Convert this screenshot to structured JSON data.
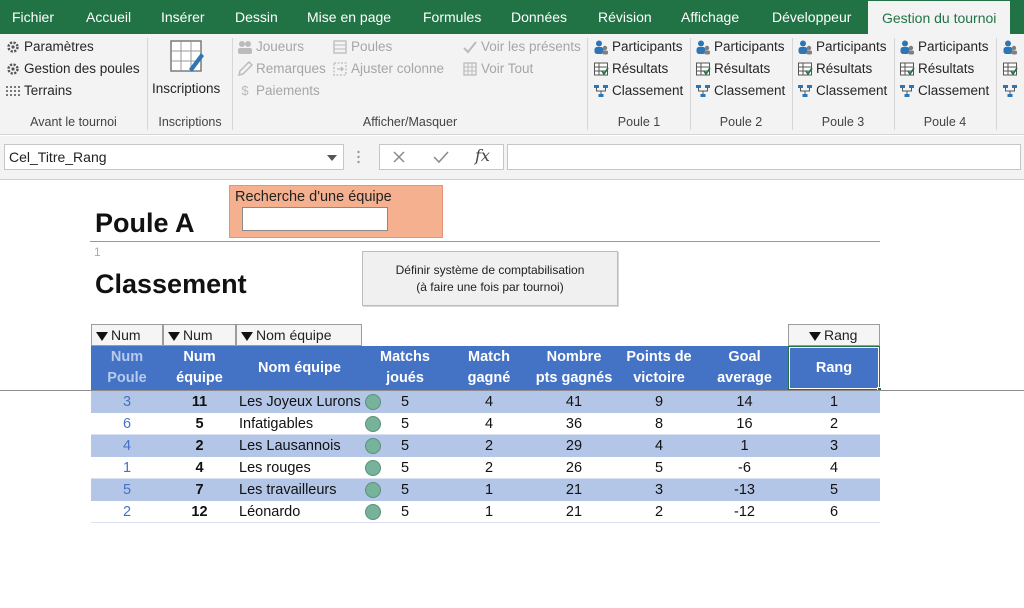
{
  "menu": {
    "tabs": [
      "Fichier",
      "Accueil",
      "Insérer",
      "Dessin",
      "Mise en page",
      "Formules",
      "Données",
      "Révision",
      "Affichage",
      "Développeur",
      "Gestion du tournoi"
    ],
    "active_tab": "Gestion du tournoi"
  },
  "ribbon": {
    "avant": {
      "items": [
        "Paramètres",
        "Gestion des poules",
        "Terrains"
      ],
      "label": "Avant le tournoi"
    },
    "inscriptions": {
      "button": "Inscriptions",
      "label": "Inscriptions"
    },
    "afficher": {
      "col1": [
        "Joueurs",
        "Remarques",
        "Paiements"
      ],
      "col2": [
        "Poules",
        "Ajuster colonne"
      ],
      "col3": [
        "Voir les présents",
        "Voir Tout"
      ],
      "label": "Afficher/Masquer"
    },
    "poule_items": [
      "Participants",
      "Résultats",
      "Classement"
    ],
    "poule_labels": [
      "Poule 1",
      "Poule 2",
      "Poule 3",
      "Poule 4"
    ]
  },
  "formula_bar": {
    "name_box": "Cel_Titre_Rang",
    "fx": "fx",
    "value": ""
  },
  "sheet": {
    "title": "Poule A",
    "row_number": "1",
    "subtitle": "Classement",
    "search": {
      "label": "Recherche d'une équipe",
      "value": ""
    },
    "define_button": [
      "Définir système de comptabilisation",
      "(à faire une fois par tournoi)"
    ],
    "filters": [
      "Num",
      "Num",
      "Nom équipe",
      "Rang"
    ],
    "headers": [
      [
        "Num",
        "Poule"
      ],
      [
        "Num",
        "équipe"
      ],
      [
        "Nom équipe"
      ],
      [
        "Matchs",
        "joués"
      ],
      [
        "Match",
        "gagné"
      ],
      [
        "Nombre",
        "pts gagnés"
      ],
      [
        "Points de",
        "victoire"
      ],
      [
        "Goal",
        "average"
      ],
      [
        "Rang"
      ]
    ],
    "rows": [
      {
        "poule": "3",
        "equipe": "11",
        "nom": "Les Joyeux Lurons",
        "joues": "5",
        "gagne": "4",
        "pts": "41",
        "victoire": "9",
        "goal": "14",
        "rang": "1"
      },
      {
        "poule": "6",
        "equipe": "5",
        "nom": "Infatigables",
        "joues": "5",
        "gagne": "4",
        "pts": "36",
        "victoire": "8",
        "goal": "16",
        "rang": "2"
      },
      {
        "poule": "4",
        "equipe": "2",
        "nom": "Les Lausannois",
        "joues": "5",
        "gagne": "2",
        "pts": "29",
        "victoire": "4",
        "goal": "1",
        "rang": "3"
      },
      {
        "poule": "1",
        "equipe": "4",
        "nom": "Les rouges",
        "joues": "5",
        "gagne": "2",
        "pts": "26",
        "victoire": "5",
        "goal": "-6",
        "rang": "4"
      },
      {
        "poule": "5",
        "equipe": "7",
        "nom": "Les travailleurs",
        "joues": "5",
        "gagne": "1",
        "pts": "21",
        "victoire": "3",
        "goal": "-13",
        "rang": "5"
      },
      {
        "poule": "2",
        "equipe": "12",
        "nom": "Léonardo",
        "joues": "5",
        "gagne": "1",
        "pts": "21",
        "victoire": "2",
        "goal": "-12",
        "rang": "6"
      }
    ]
  },
  "colors": {
    "excel_green": "#217346",
    "header_blue": "#4472c4",
    "band_blue": "#b4c6e7",
    "search_orange": "#f4b08f",
    "status_dot": "#76b39a"
  },
  "icons": {
    "parametres": "gear-icon",
    "poules": "dotted-grid-icon",
    "terrains": "dotted-grid-icon",
    "inscriptions": "form-pencil-icon",
    "joueurs": "people-icon",
    "remarques": "pencil-icon",
    "paiements": "dollar-icon",
    "ajuster": "resize-icon",
    "voir_presents": "check-icon",
    "voir_tout": "table-icon",
    "participants": "users-icon",
    "resultats": "table-icon",
    "classement": "ranking-icon",
    "status": "status-dot-icon"
  }
}
